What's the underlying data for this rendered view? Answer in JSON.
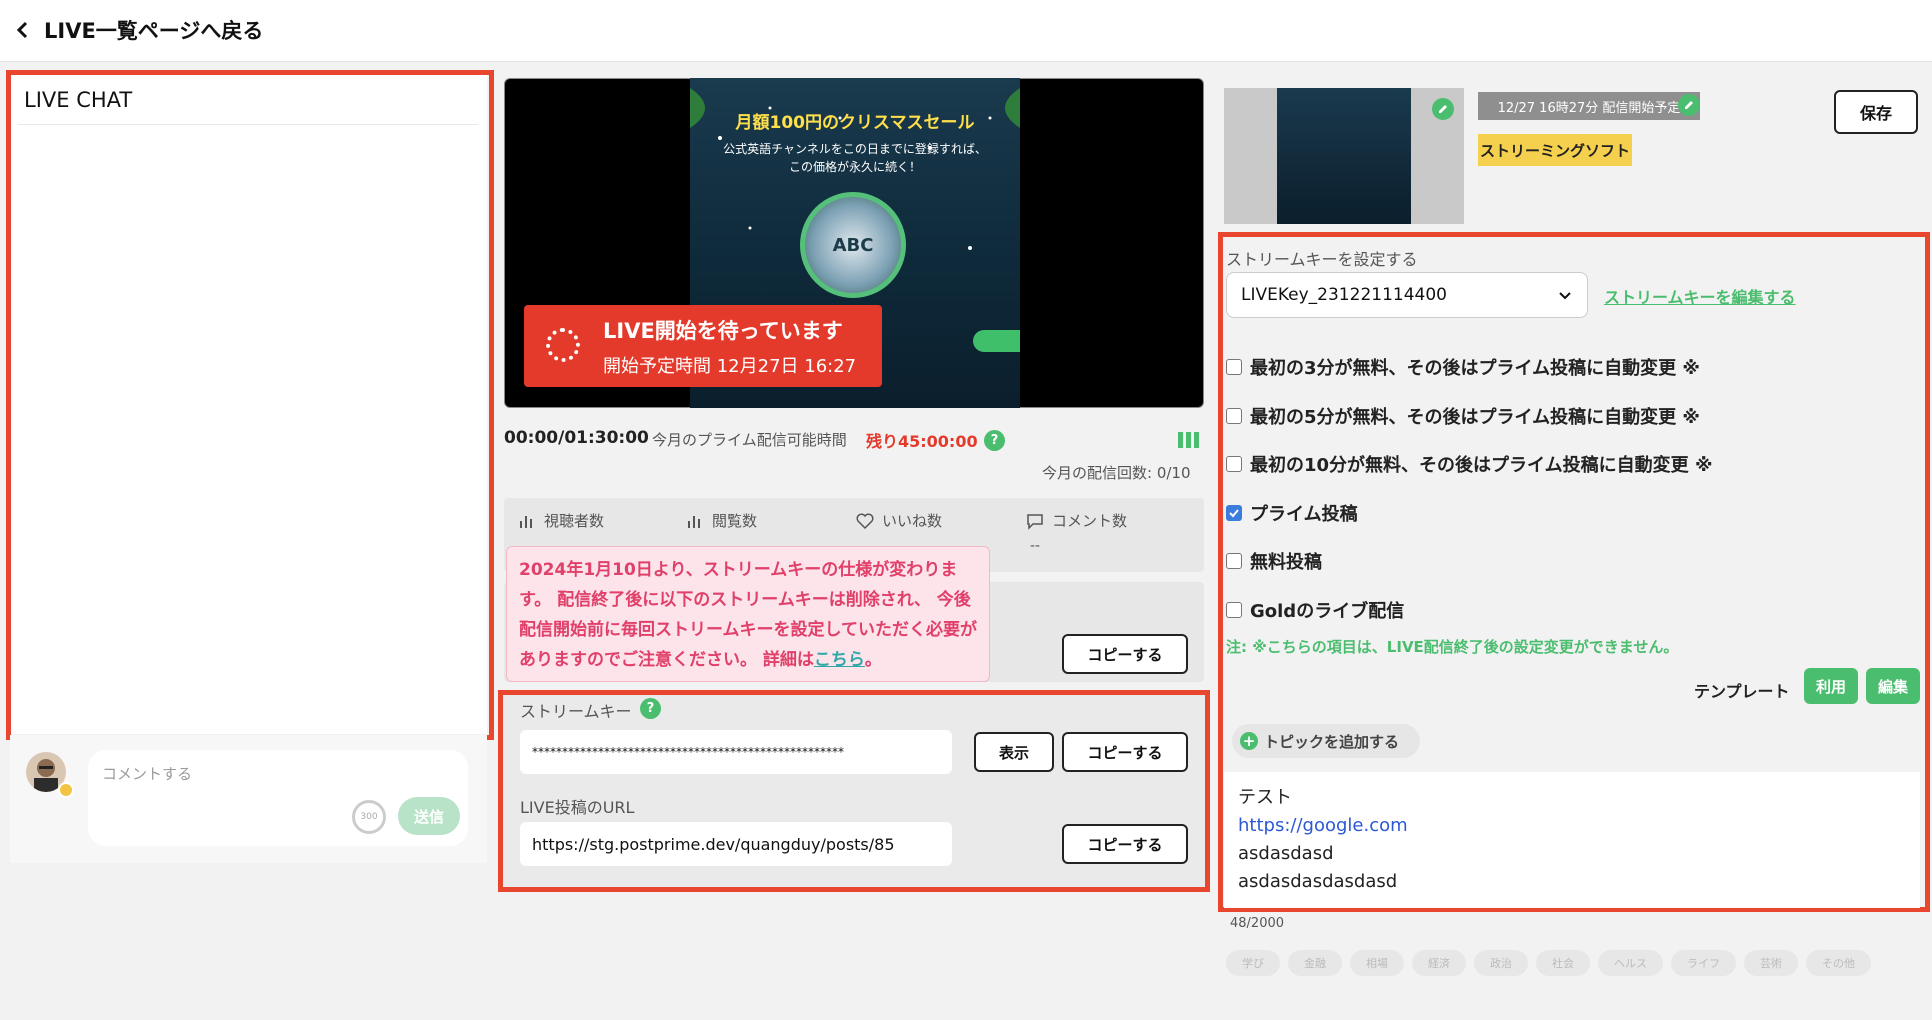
{
  "header": {
    "back_label": "LIVE一覧ページへ戻る"
  },
  "chat": {
    "title": "LIVE CHAT",
    "comment_placeholder": "コメントする",
    "char_limit": "300",
    "send_label": "送信"
  },
  "video": {
    "promo_title": "月額100円のクリスマスセール",
    "promo_subtitle": "公式英語チャンネルをこの日までに登録すれば、\nこの価格が永久に続く！",
    "logo_text": "ABC",
    "waiting_title": "LIVE開始を待っています",
    "waiting_sub": "開始予定時間 12月27日 16:27"
  },
  "status": {
    "elapsed": "00:00/01:30:00",
    "prime_label": "今月のプライム配信可能時間",
    "remaining": "残り45:00:00",
    "help": "?",
    "monthly_count": "今月の配信回数: 0/10"
  },
  "stats": {
    "viewers": "視聴者数",
    "views": "閲覧数",
    "likes": "いいね数",
    "comments": "コメント数",
    "comments_value": "--"
  },
  "notice": {
    "text": "2024年1月10日より、ストリームキーの仕様が変わります。 配信終了後に以下のストリームキーは削除され、 今後配信開始前に毎回ストリームキーを設定していただく必要がありますのでご注意ください。 詳細は",
    "link": "こちら",
    "end": "。"
  },
  "copy": {
    "copy_label": "コピーする",
    "show_label": "表示"
  },
  "stream": {
    "key_label": "ストリームキー",
    "key_value": "****************************************************",
    "url_label": "LIVE投稿のURL",
    "url_value": "https://stg.postprime.dev/quangduy/posts/85"
  },
  "right": {
    "schedule": "12/27 16時27分 配信開始予定",
    "software": "ストリーミングソフト",
    "save": "保存",
    "sk_label": "ストリームキーを設定する",
    "sk_selected": "LIVEKey_231221114400",
    "sk_edit": "ストリームキーを編集する",
    "options": [
      {
        "label": "最初の3分が無料、その後はプライム投稿に自動変更 ※",
        "checked": false
      },
      {
        "label": "最初の5分が無料、その後はプライム投稿に自動変更 ※",
        "checked": false
      },
      {
        "label": "最初の10分が無料、その後はプライム投稿に自動変更 ※",
        "checked": false
      },
      {
        "label": "プライム投稿",
        "checked": true
      },
      {
        "label": "無料投稿",
        "checked": false
      },
      {
        "label": "Goldのライブ配信",
        "checked": false
      }
    ],
    "note": "注: ※こちらの項目は、LIVE配信終了後の設定変更ができません。",
    "template_label": "テンプレート",
    "use_label": "利用",
    "edit_label": "編集",
    "add_topic": "トピックを追加する",
    "desc_lines": [
      "テスト",
      "https://google.com",
      "asdasdasd",
      "asdasdasdasdasd"
    ],
    "char_count": "48/2000",
    "tags": [
      "学び",
      "金融",
      "相場",
      "経済",
      "政治",
      "社会",
      "ヘルス",
      "ライフ",
      "芸術",
      "その他"
    ]
  },
  "colors": {
    "accent_green": "#4bbd6e",
    "alert_red": "#e33a2c",
    "highlight_red": "#e8462e",
    "yellow": "#f5cf4e"
  }
}
